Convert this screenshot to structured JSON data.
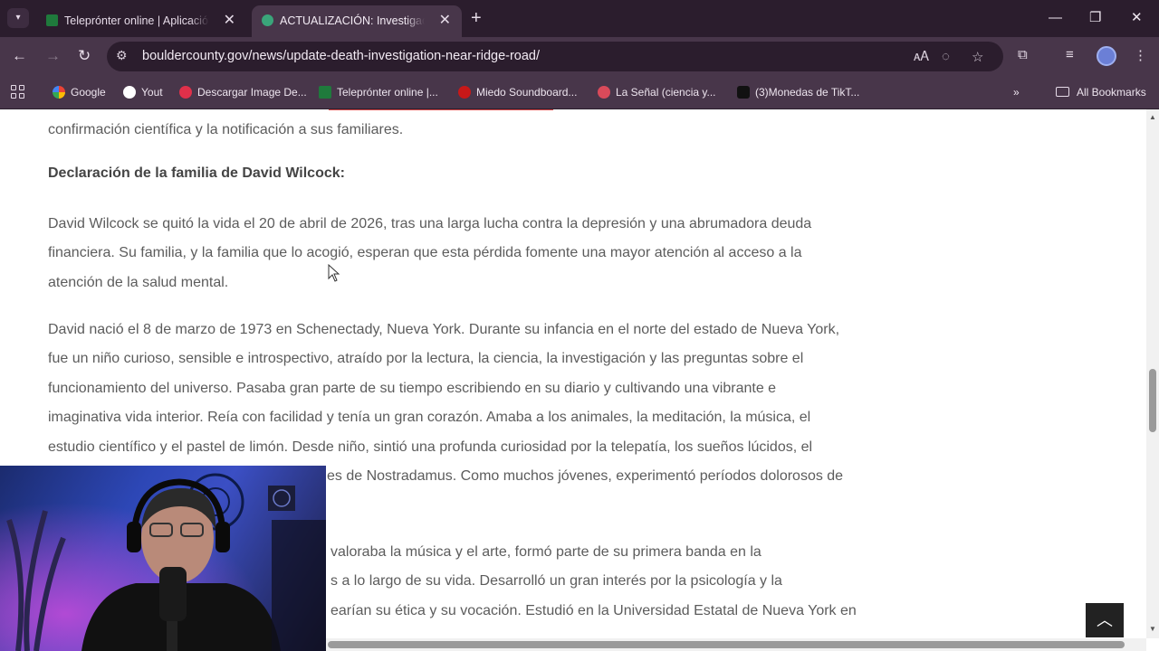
{
  "tabs": [
    {
      "title": "Teleprónter online | Aplicación de teleprompter",
      "favicon_color": "#1f7a3c",
      "active": false
    },
    {
      "title": "ACTUALIZACIÓN: Investigación de muerte",
      "favicon_color": "#3aa57a",
      "active": true
    }
  ],
  "browser": {
    "url": "bouldercounty.gov/news/update-death-investigation-near-ridge-road/"
  },
  "bookmarks": [
    {
      "label": "Google",
      "color": "#4285f4"
    },
    {
      "label": "Yout",
      "color": "#ffffff"
    },
    {
      "label": "Descargar Image De...",
      "color": "#e0304a"
    },
    {
      "label": "Teleprónter online |...",
      "color": "#1f7a3c"
    },
    {
      "label": "Miedo Soundboard...",
      "color": "#c81818"
    },
    {
      "label": "La Señal (ciencia y...",
      "color": "#d94a5a"
    },
    {
      "label": "(3)Monedas de TikT...",
      "color": "#111111"
    }
  ],
  "all_bookmarks_label": "All Bookmarks",
  "article": {
    "line_top": "confirmación científica y la notificación a sus familiares.",
    "heading": "Declaración de la familia de David Wilcock:",
    "p1": [
      "David Wilcock se quitó la vida el 20 de abril de 2026, tras una larga lucha contra la depresión y una abrumadora deuda",
      "financiera. Su familia, y la familia que lo acogió, esperan que esta pérdida fomente una mayor atención al acceso a la",
      "atención de la salud mental."
    ],
    "p2": [
      "David nació el 8 de marzo de 1973 en Schenectady, Nueva York. Durante su infancia en el norte del estado de Nueva York,",
      "fue un niño curioso, sensible e introspectivo, atraído por la lectura, la ciencia, la investigación y las preguntas sobre el",
      "funcionamiento del universo. Pasaba gran parte de su tiempo escribiendo en su diario y cultivando una vibrante e",
      "imaginativa vida interior. Reía con facilidad y tenía un gran corazón. Amaba a los animales, la meditación, la música, el",
      "estudio científico y el pastel de limón. Desde niño, sintió una profunda curiosidad por la telepatía, los sueños lúcidos, el",
      "es de Nostradamus. Como muchos jóvenes, experimentó períodos dolorosos de"
    ],
    "p3": [
      "valoraba la música y el arte, formó parte de su primera banda en la",
      "s a lo largo de su vida. Desarrolló un gran interés por la psicología y la",
      "earían su ética y su vocación. Estudió en la Universidad Estatal de Nueva York en"
    ]
  },
  "icons": {
    "back_to_top": "chevron-up-icon"
  }
}
